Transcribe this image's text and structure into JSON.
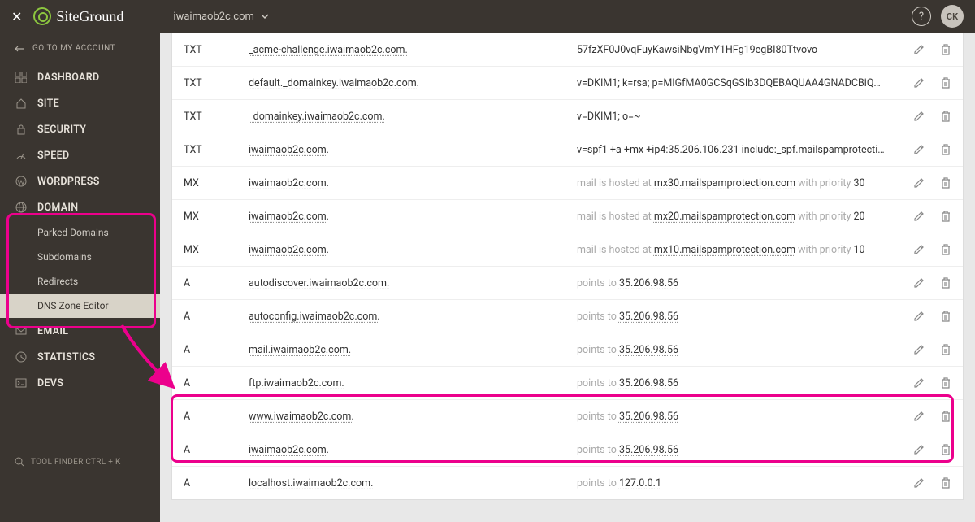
{
  "topbar": {
    "logo_text": "SiteGround",
    "domain": "iwaimaob2c.com",
    "avatar_initials": "CK"
  },
  "sidebar": {
    "back_label": "GO TO MY ACCOUNT",
    "items": [
      {
        "label": "DASHBOARD",
        "icon": "grid"
      },
      {
        "label": "SITE",
        "icon": "home"
      },
      {
        "label": "SECURITY",
        "icon": "lock"
      },
      {
        "label": "SPEED",
        "icon": "speed"
      },
      {
        "label": "WORDPRESS",
        "icon": "wordpress"
      },
      {
        "label": "DOMAIN",
        "icon": "globe"
      },
      {
        "label": "EMAIL",
        "icon": "mail"
      },
      {
        "label": "STATISTICS",
        "icon": "clock"
      },
      {
        "label": "DEVS",
        "icon": "terminal"
      }
    ],
    "domain_sub": [
      {
        "label": "Parked Domains"
      },
      {
        "label": "Subdomains"
      },
      {
        "label": "Redirects"
      },
      {
        "label": "DNS Zone Editor",
        "active": true
      }
    ],
    "tool_finder": "TOOL FINDER CTRL + K"
  },
  "records": [
    {
      "type": "TXT",
      "host": "_acme-challenge.iwaimaob2c.com.",
      "value_mode": "plain",
      "value": "57fzXF0J0vqFuyKawsiNbgVmY1HFg19egBI80Ttvovo"
    },
    {
      "type": "TXT",
      "host": "default._domainkey.iwaimaob2c.com.",
      "value_mode": "plain",
      "value": "v=DKIM1; k=rsa; p=MIGfMA0GCSqGSIb3DQEBAQUAA4GNADCBiQ…"
    },
    {
      "type": "TXT",
      "host": "_domainkey.iwaimaob2c.com.",
      "value_mode": "plain",
      "value": "v=DKIM1; o=~"
    },
    {
      "type": "TXT",
      "host": "iwaimaob2c.com.",
      "value_mode": "plain",
      "value": "v=spf1 +a +mx +ip4:35.206.106.231 include:_spf.mailspamprotecti…"
    },
    {
      "type": "MX",
      "host": "iwaimaob2c.com.",
      "value_mode": "mx",
      "mx_host": "mx30.mailspamprotection.com",
      "mx_prio": "30"
    },
    {
      "type": "MX",
      "host": "iwaimaob2c.com.",
      "value_mode": "mx",
      "mx_host": "mx20.mailspamprotection.com",
      "mx_prio": "20"
    },
    {
      "type": "MX",
      "host": "iwaimaob2c.com.",
      "value_mode": "mx",
      "mx_host": "mx10.mailspamprotection.com",
      "mx_prio": "10"
    },
    {
      "type": "A",
      "host": "autodiscover.iwaimaob2c.com.",
      "value_mode": "a",
      "a_ip": "35.206.98.56"
    },
    {
      "type": "A",
      "host": "autoconfig.iwaimaob2c.com.",
      "value_mode": "a",
      "a_ip": "35.206.98.56"
    },
    {
      "type": "A",
      "host": "mail.iwaimaob2c.com.",
      "value_mode": "a",
      "a_ip": "35.206.98.56"
    },
    {
      "type": "A",
      "host": "ftp.iwaimaob2c.com.",
      "value_mode": "a",
      "a_ip": "35.206.98.56"
    },
    {
      "type": "A",
      "host": "www.iwaimaob2c.com.",
      "value_mode": "a",
      "a_ip": "35.206.98.56"
    },
    {
      "type": "A",
      "host": "iwaimaob2c.com.",
      "value_mode": "a",
      "a_ip": "35.206.98.56"
    },
    {
      "type": "A",
      "host": "localhost.iwaimaob2c.com.",
      "value_mode": "a",
      "a_ip": "127.0.0.1"
    }
  ],
  "strings": {
    "mail_hosted": "mail is hosted at ",
    "with_priority": " with priority ",
    "points_to": "points to "
  }
}
